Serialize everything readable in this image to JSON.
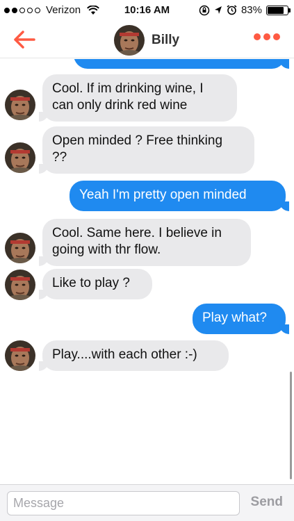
{
  "status_bar": {
    "carrier": "Verizon",
    "signal_dots_filled": 2,
    "signal_dots_total": 5,
    "time": "10:16 AM",
    "battery_percent_label": "83%",
    "battery_level": 0.83,
    "icons": [
      "wifi-icon",
      "rotation-lock-icon",
      "location-arrow-icon",
      "alarm-icon",
      "battery-icon"
    ]
  },
  "header": {
    "contact_name": "Billy",
    "back_icon": "back-arrow-icon",
    "more_icon": "more-dots-icon",
    "accent_color": "#fe5a43"
  },
  "messages": [
    {
      "direction": "out",
      "text": "",
      "partial": true
    },
    {
      "direction": "in",
      "lines": [
        "Cool. If im drinking wine, I",
        "can only drink red wine"
      ]
    },
    {
      "direction": "in",
      "lines": [
        "Open minded ? Free thinking",
        "??"
      ]
    },
    {
      "direction": "out",
      "lines": [
        "Yeah I'm pretty open minded"
      ]
    },
    {
      "direction": "in",
      "lines": [
        "Cool. Same here. I believe in",
        "going with thr flow."
      ]
    },
    {
      "direction": "in",
      "lines": [
        "Like to play ?"
      ]
    },
    {
      "direction": "out",
      "lines": [
        "Play what?"
      ]
    },
    {
      "direction": "in",
      "lines": [
        "Play....with each other :-)"
      ]
    }
  ],
  "colors": {
    "outgoing_bubble": "#1f8af0",
    "incoming_bubble": "#e9e9eb"
  },
  "composer": {
    "placeholder": "Message",
    "value": "",
    "send_label": "Send"
  }
}
